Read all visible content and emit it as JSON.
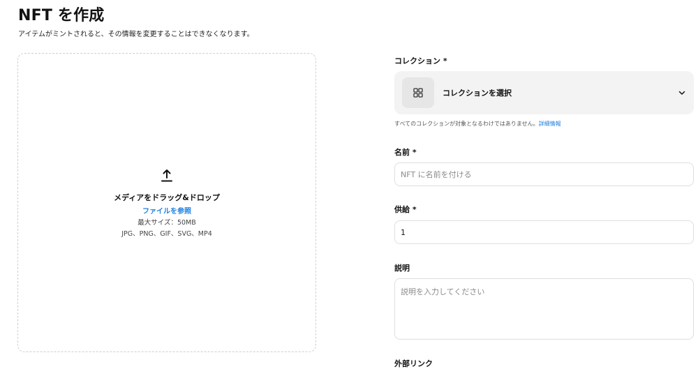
{
  "header": {
    "title": "NFT を作成",
    "subtitle": "アイテムがミントされると、その情報を変更することはできなくなります。"
  },
  "upload": {
    "title": "メディアをドラッグ&ドロップ",
    "browse_label": "ファイルを参照",
    "max_size": "最大サイズ：50MB",
    "formats": "JPG、PNG、GIF、SVG、MP4"
  },
  "form": {
    "collection": {
      "label": "コレクション *",
      "select_text": "コレクションを選択",
      "helper_text": "すべてのコレクションが対象となるわけではありません。",
      "helper_link": "詳細情報"
    },
    "name": {
      "label": "名前 *",
      "placeholder": "NFT に名前を付ける"
    },
    "supply": {
      "label": "供給 *",
      "value": "1"
    },
    "description": {
      "label": "説明",
      "placeholder": "説明を入力してください"
    },
    "external_link": {
      "label": "外部リンク"
    }
  },
  "colors": {
    "accent": "#2081e2",
    "text": "#121212",
    "input_border": "#dedede",
    "select_bg": "#f3f3f3"
  }
}
